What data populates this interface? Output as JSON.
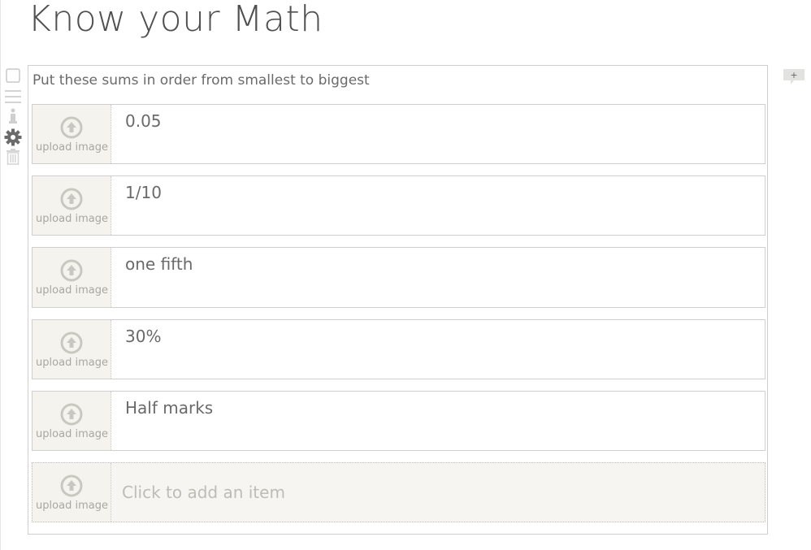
{
  "page": {
    "title": "Know your Math"
  },
  "question": {
    "prompt": "Put these sums in order from smallest to biggest",
    "items": [
      {
        "text": "0.05",
        "upload_label": "upload image"
      },
      {
        "text": "1/10",
        "upload_label": "upload image"
      },
      {
        "text": "one fifth",
        "upload_label": "upload image"
      },
      {
        "text": "30%",
        "upload_label": "upload image"
      },
      {
        "text": "Half marks",
        "upload_label": "upload image"
      }
    ],
    "add_item": {
      "placeholder": "Click to add an item",
      "upload_label": "upload image"
    }
  },
  "toolbar": {
    "icons": [
      "checkbox-icon",
      "drag-handle-icon",
      "info-icon",
      "gear-icon",
      "trash-icon"
    ]
  },
  "comment": {
    "icon": "add-comment-icon",
    "label": "+"
  },
  "colors": {
    "border": "#cfcfcf",
    "upload_bg": "#f4f3ee",
    "text": "#6a6a6a",
    "muted": "#a8a8a0"
  }
}
